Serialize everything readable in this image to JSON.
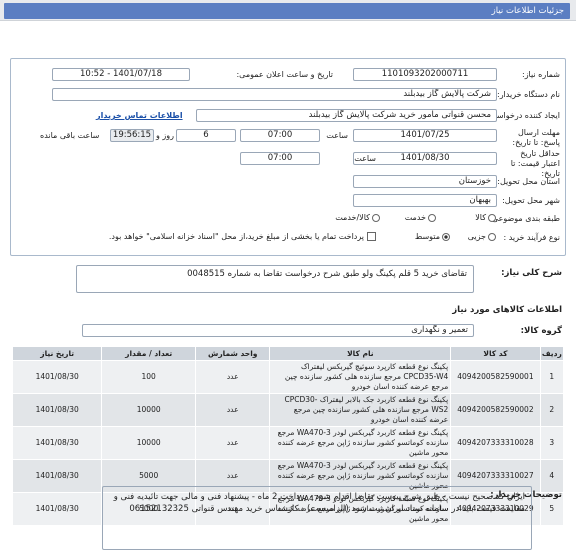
{
  "header": {
    "title": "جزئیات اطلاعات نیاز"
  },
  "form": {
    "need_number_label": "شماره نیاز:",
    "need_number": "1101093202000711",
    "announce_label": "تاریخ و ساعت اعلان عمومی:",
    "announce_value": "1401/07/18 - 10:52",
    "buyer_org_label": "نام دستگاه خریدار:",
    "buyer_org": "شرکت پالایش گاز بیدبلند",
    "requester_label": "ایجاد کننده درخواست:",
    "requester": "محسن قنواتی مامور خرید شرکت پالایش گاز بیدبلند",
    "contact_link": "اطلاعات تماس خریدار",
    "deadline_label": "مهلت ارسال پاسخ: تا تاریخ:",
    "deadline_date": "1401/07/25",
    "time_label": "ساعت",
    "deadline_time": "07:00",
    "days_value": "6",
    "days_label": "روز و",
    "remaining_time": "19:56:15",
    "remaining_label": "ساعت باقی مانده",
    "validity_label": "حداقل تاریخ اعتبار قیمت: تا تاریخ:",
    "validity_date": "1401/08/30",
    "validity_time_label": "ساعت",
    "validity_time": "07:00",
    "province_label": "استان محل تحویل:",
    "province": "خوزستان",
    "city_label": "شهر محل تحویل:",
    "city": "بهبهان",
    "category_label": "طبقه بندی موضوعی:",
    "category_options": [
      "کالا",
      "خدمت",
      "کالا/خدمت"
    ],
    "process_label": "نوع فرآیند خرید :",
    "process_options": [
      "جزیی",
      "متوسط"
    ],
    "process_note": "پرداخت تمام یا بخشی از مبلغ خرید،از محل \"اسناد خزانه اسلامی\" خواهد بود."
  },
  "description": {
    "label": "شرح کلی نیاز:",
    "text": "تقاضای خرید 5 قلم پکینگ ولو طبق شرح درخواست تقاضا به شماره 0048515"
  },
  "goods": {
    "section_title": "اطلاعات کالاهای مورد نیاز",
    "group_label": "گروه کالا:",
    "group_value": "تعمیر و نگهداری",
    "columns": [
      "ردیف",
      "کد کالا",
      "نام کالا",
      "واحد شمارش",
      "تعداد / مقدار",
      "تاریخ نیاز"
    ],
    "rows": [
      {
        "idx": "1",
        "code": "4094200582590001",
        "name": "پکینگ نوع قطعه کارپرد سوئیچ گیربکس لیفتراک CPCD35-W4 مرجع سازنده هلی کشور سازنده چین مرجع عرضه کننده اسان خودرو",
        "unit": "عدد",
        "qty": "100",
        "date": "1401/08/30"
      },
      {
        "idx": "2",
        "code": "4094200582590002",
        "name": "پکینگ نوع قطعه کاربرد جک بالابر لیفتراک CPCD30-WS2 مرجع سازنده هلی کشور سازنده چین مرجع عرضه کننده اسان خودرو",
        "unit": "عدد",
        "qty": "10000",
        "date": "1401/08/30"
      },
      {
        "idx": "3",
        "code": "4094207333310028",
        "name": "پکینگ نوع قطعه کاربرد گیربکس لودر WA470-3 مرجع سازنده کوماتسو کشور سازنده ژاپن مرجع عرضه کننده محور ماشین",
        "unit": "عدد",
        "qty": "10000",
        "date": "1401/08/30"
      },
      {
        "idx": "4",
        "code": "4094207333310027",
        "name": "پکینگ نوع قطعه کاربرد گیربکس لودر WA470-3 مرجع سازنده کوماتسو کشور سازنده ژاپن مرجع عرضه کننده محور ماشین",
        "unit": "عدد",
        "qty": "5000",
        "date": "1401/08/30"
      },
      {
        "idx": "5",
        "code": "4094207333310029",
        "name": "پکینگ نوع قطعه کاربرد گیربکس لودر WA470-3 مرجع سازنده کوماتسو کشور سازنده ژاپن مرجع عرضه کننده محور ماشین",
        "unit": "عدد",
        "qty": "5000",
        "date": "1401/08/30"
      }
    ]
  },
  "notes": {
    "label": "توضیحات خریدار:",
    "text": "ایران کد صحیح نیست - طبق شرح پیوست تقاضا اقدام شود - پرداخت 2 ماه - پیشنهاد فنی و مالی جهت تائیدیه فنی و مقایسه قیمت باید در سامانه ستاد ایران ثبت شود (الزامیست) - کارشناس خرید مهندس قنواتی 06152132325"
  }
}
